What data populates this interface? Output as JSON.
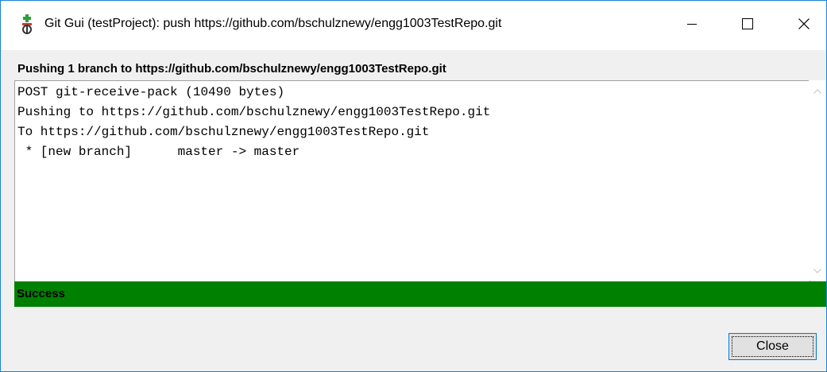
{
  "window": {
    "title": "Git Gui (testProject): push https://github.com/bschulznewy/engg1003TestRepo.git",
    "controls": {
      "minimize_icon": "minimize-icon",
      "maximize_icon": "maximize-icon",
      "close_icon": "close-icon"
    },
    "app_icon": "git-gui-icon"
  },
  "push": {
    "heading": "Pushing 1 branch to https://github.com/bschulznewy/engg1003TestRepo.git",
    "output_lines": [
      "POST git-receive-pack (10490 bytes)",
      "Pushing to https://github.com/bschulznewy/engg1003TestRepo.git",
      "To https://github.com/bschulznewy/engg1003TestRepo.git",
      " * [new branch]      master -> master"
    ]
  },
  "status": {
    "text": "Success",
    "color": "#008000"
  },
  "buttons": {
    "close_label": "Close"
  },
  "colors": {
    "window_border": "#1883d7",
    "icon_green": "#2e9e3a",
    "icon_red": "#d23a2a"
  }
}
